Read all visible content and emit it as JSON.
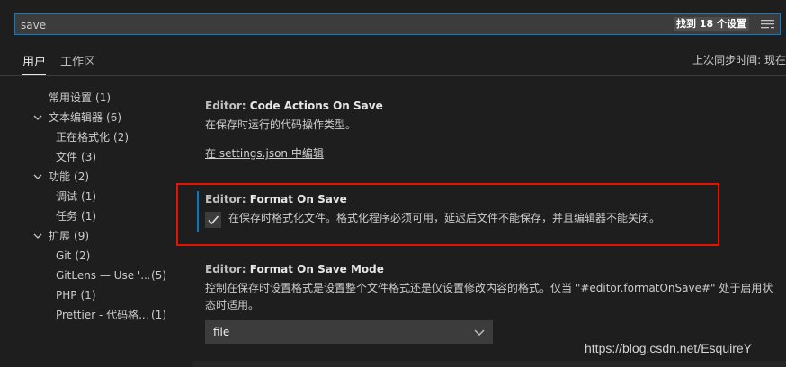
{
  "search": {
    "value": "save",
    "result_count": "找到 18 个设置"
  },
  "tabs": [
    {
      "label": "用户"
    },
    {
      "label": "工作区"
    }
  ],
  "sync_status": "上次同步时间: 现在",
  "toc": [
    {
      "label": "常用设置",
      "count": "(1)"
    },
    {
      "label": "文本编辑器",
      "count": "(6)"
    },
    {
      "label": "正在格式化",
      "count": "(2)"
    },
    {
      "label": "文件",
      "count": "(3)"
    },
    {
      "label": "功能",
      "count": "(2)"
    },
    {
      "label": "调试",
      "count": "(1)"
    },
    {
      "label": "任务",
      "count": "(1)"
    },
    {
      "label": "扩展",
      "count": "(9)"
    },
    {
      "label": "Git",
      "count": "(2)"
    },
    {
      "label": "GitLens — Use '...",
      "count": "(5)"
    },
    {
      "label": "PHP",
      "count": "(1)"
    },
    {
      "label": "Prettier - 代码格...",
      "count": "(1)"
    }
  ],
  "settings": {
    "code_actions": {
      "category": "Editor: ",
      "name": "Code Actions On Save",
      "description": "在保存时运行的代码操作类型。",
      "link": "在 settings.json 中编辑"
    },
    "format_on_save": {
      "category": "Editor: ",
      "name": "Format On Save",
      "description": "在保存时格式化文件。格式化程序必须可用，延迟后文件不能保存，并且编辑器不能关闭。",
      "checked": true
    },
    "format_on_save_mode": {
      "category": "Editor: ",
      "name": "Format On Save Mode",
      "description": "控制在保存时设置格式是设置整个文件格式还是仅设置修改内容的格式。仅当 \"#editor.formatOnSave#\" 处于启用状态时适用。",
      "value": "file"
    }
  },
  "watermark": "https://blog.csdn.net/EsquireY",
  "colors": {
    "accent": "#007acc",
    "highlight_border": "#e51400",
    "background": "#1e1e1e"
  },
  "icons": {
    "filter": "filter-icon",
    "chevron": "chevron-down-icon",
    "check": "check-icon",
    "dropdown": "chevron-down-icon"
  }
}
